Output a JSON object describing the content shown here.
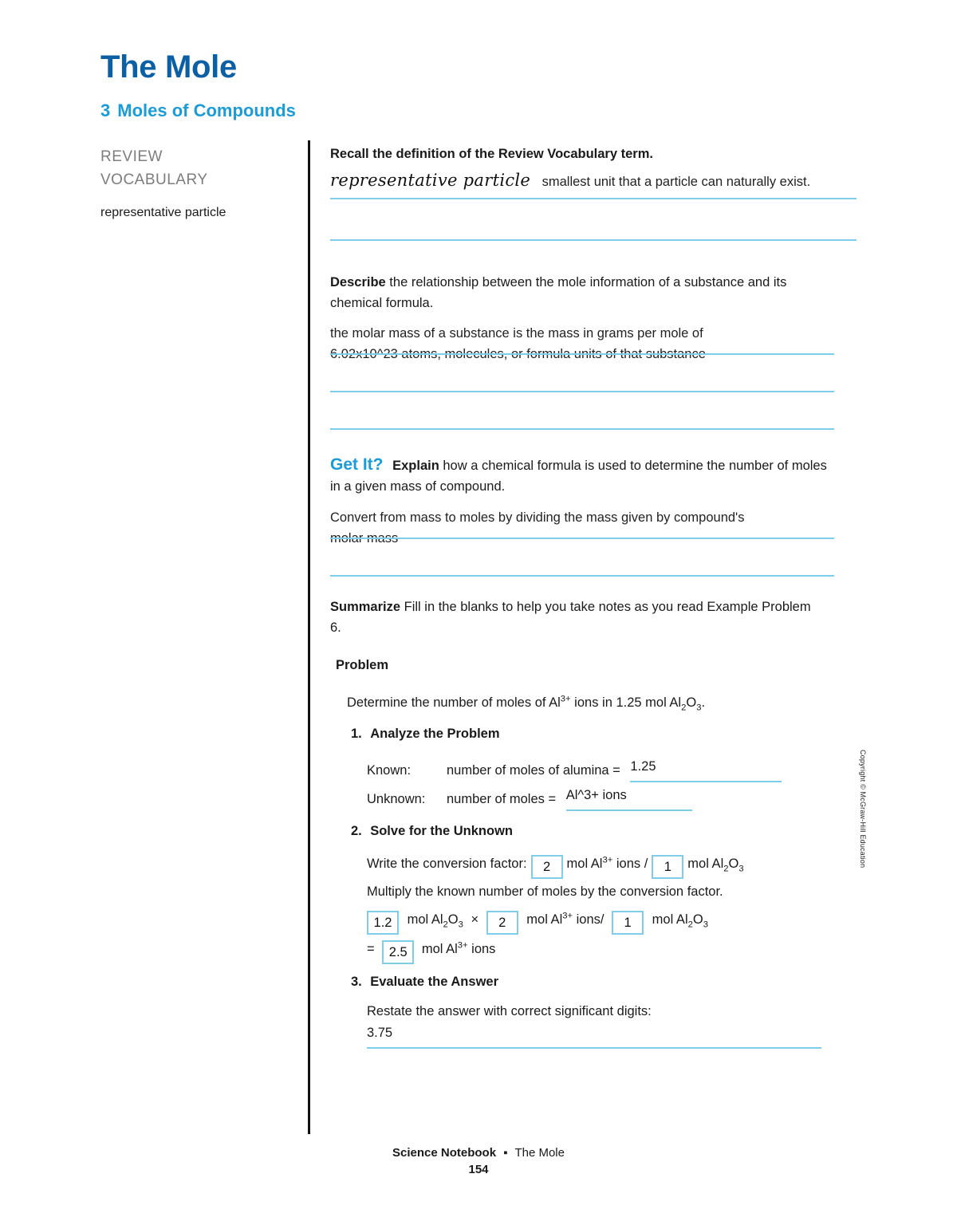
{
  "header": {
    "title": "The Mole",
    "section_number": "3",
    "section_title": "Moles of Compounds"
  },
  "sidebar": {
    "label_line1": "REVIEW",
    "label_line2": "VOCABULARY",
    "term": "representative particle"
  },
  "vocab": {
    "prompt_bold": "Recall the definition of the Review Vocabulary term.",
    "term": "representative particle",
    "answer": "smallest unit that a particle can naturally exist."
  },
  "describe": {
    "prompt_bold": "Describe",
    "prompt_rest": " the relationship between the mole information of a substance and its chemical formula.",
    "answer_line1": "the molar mass of a substance is the mass in grams per mole of",
    "answer_line2": "6.02x10^23 atoms, molecules, or formula units of that substance"
  },
  "getit": {
    "label": "Get It?",
    "prompt_bold": "Explain",
    "prompt_rest": " how a chemical formula is used to determine the number of moles in a given mass of compound.",
    "answer_line1": "Convert from mass to moles by dividing the mass given by compound's",
    "answer_line2": "molar mass"
  },
  "summarize": {
    "label": "Summarize",
    "text": " Fill in the blanks to help you take notes as you read Example Problem 6."
  },
  "problem": {
    "heading": "Problem",
    "statement_pre": "Determine the number of moles of Al",
    "statement_sup": "3+",
    "statement_mid": " ions in 1.25 mol Al",
    "statement_sub1": "2",
    "statement_o": "O",
    "statement_sub2": "3",
    "statement_end": ".",
    "steps": [
      {
        "number": "1.",
        "title": "Analyze the Problem",
        "known_label": "Known:",
        "known_text": "number of moles of alumina =",
        "known_value": "1.25",
        "unknown_label": "Unknown:",
        "unknown_text": "number of moles =",
        "unknown_value": "Al^3+ ions"
      },
      {
        "number": "2.",
        "title": "Solve for the Unknown",
        "conv_label": "Write the conversion factor:",
        "conv_box1": "2",
        "conv_mid": "mol Al",
        "conv_sup": "3+",
        "conv_ions": "ions /",
        "conv_box2": "1",
        "conv_end": "mol Al",
        "multiply_text": "Multiply the known number of moles by the conversion factor.",
        "calc_box1": "1.2",
        "calc_unit1": "mol Al",
        "calc_times": "×",
        "calc_box2": "2",
        "calc_unit2": "mol Al",
        "calc_ions": "ions/",
        "calc_box3": "1",
        "calc_unit3": "mol Al",
        "result_eq": "=",
        "result_box": "2.5",
        "result_unit": "mol Al",
        "result_ions": "ions"
      },
      {
        "number": "3.",
        "title": "Evaluate the Answer",
        "restate_text": "Restate the answer with correct significant digits:",
        "restate_value": "3.75"
      }
    ]
  },
  "footer": {
    "book": "Science Notebook",
    "separator": "▪",
    "chapter": "The Mole",
    "page_number": "154"
  },
  "copyright": "Copyright © McGraw-Hill Education",
  "colors": {
    "title_blue": "#0B5FA5",
    "accent_blue": "#1B9CD8",
    "rule_blue": "#7FCDEB",
    "gray_label": "#7d7d7d"
  }
}
